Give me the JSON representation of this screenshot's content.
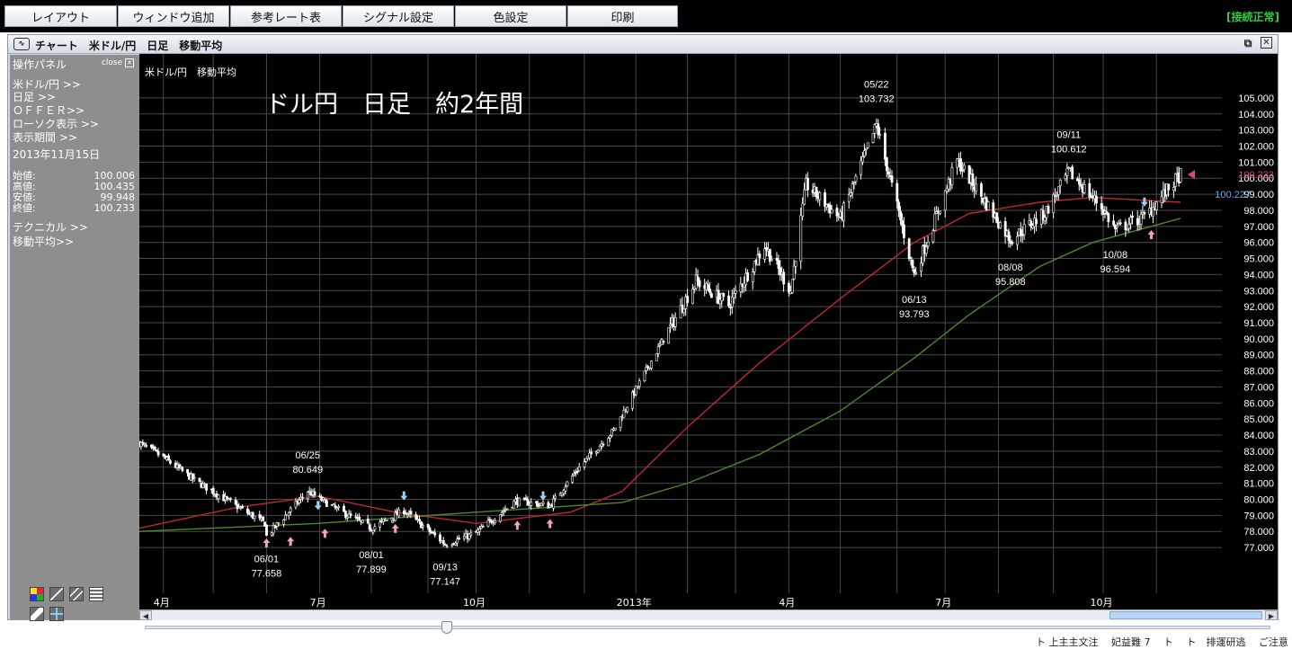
{
  "menu": {
    "items": [
      "レイアウト",
      "ウィンドウ追加",
      "参考レート表",
      "シグナル設定",
      "色設定",
      "印刷"
    ],
    "status": "[接続正常]"
  },
  "window": {
    "title": "チャート　米ドル/円　日足　移動平均",
    "icon": "chart-wave-icon",
    "controls": [
      "popout-icon",
      "close-icon"
    ]
  },
  "panel": {
    "title": "操作パネル",
    "close_label": "close",
    "links": [
      "米ドル/円 >>",
      "日足 >>",
      "ＯＦＦＥＲ>>",
      "ローソク表示 >>",
      "表示期間 >>"
    ],
    "date": "2013年11月15日",
    "ohlc": [
      {
        "label": "始値:",
        "value": "100.006"
      },
      {
        "label": "高値:",
        "value": "100.435"
      },
      {
        "label": "安値:",
        "value": "99.948"
      },
      {
        "label": "終値:",
        "value": "100.233"
      }
    ],
    "technical_link": "テクニカル >>",
    "ma_link": "移動平均>>",
    "tool_icons": [
      "color-palette-icon",
      "line-draw-icon",
      "parallel-lines-icon",
      "list-icon",
      "eraser-icon",
      "crosshair-icon"
    ]
  },
  "chart": {
    "subtitle": "米ドル/円　移動平均",
    "overlay_title": "ドル円　日足　約2年間",
    "colors": {
      "candle": "#ffffff",
      "ma_short": "#c0282d",
      "ma_long": "#4d8a2a",
      "grid": "#4a4a4a",
      "last_price": "#e0447a",
      "ma_value": "#6fa0e8",
      "buy_arrow": "#f2a6b8",
      "sell_arrow": "#9fd0f2"
    },
    "last_price": "100.233",
    "ma_value": "100.227",
    "annotations": [
      {
        "date": "06/01",
        "price": "77.658"
      },
      {
        "date": "06/25",
        "price": "80.649"
      },
      {
        "date": "08/01",
        "price": "77.899"
      },
      {
        "date": "09/13",
        "price": "77.147"
      },
      {
        "date": "05/22",
        "price": "103.732"
      },
      {
        "date": "06/13",
        "price": "93.793"
      },
      {
        "date": "08/08",
        "price": "95.808"
      },
      {
        "date": "09/11",
        "price": "100.612"
      },
      {
        "date": "10/08",
        "price": "96.594"
      }
    ]
  },
  "chart_data": {
    "type": "candlestick",
    "ylim": [
      76.5,
      105.5
    ],
    "y_ticks": [
      "77.000",
      "78.000",
      "79.000",
      "80.000",
      "81.000",
      "82.000",
      "83.000",
      "84.000",
      "85.000",
      "86.000",
      "87.000",
      "88.000",
      "89.000",
      "90.000",
      "91.000",
      "92.000",
      "93.000",
      "94.000",
      "95.000",
      "96.000",
      "97.000",
      "98.000",
      "99.000",
      "100.000",
      "101.000",
      "102.000",
      "103.000",
      "104.000",
      "105.000"
    ],
    "x_ticks": [
      "4月",
      "7月",
      "10月",
      "2013年",
      "4月",
      "7月",
      "10月"
    ],
    "close_path": [
      {
        "date": "2012-03-19",
        "close": 83.5
      },
      {
        "date": "2012-04-02",
        "close": 82.6
      },
      {
        "date": "2012-04-20",
        "close": 81.2
      },
      {
        "date": "2012-05-08",
        "close": 80.0
      },
      {
        "date": "2012-05-31",
        "close": 78.5
      },
      {
        "date": "2012-06-01",
        "close": 77.7
      },
      {
        "date": "2012-06-25",
        "close": 80.5
      },
      {
        "date": "2012-07-10",
        "close": 79.5
      },
      {
        "date": "2012-08-01",
        "close": 78.2
      },
      {
        "date": "2012-08-20",
        "close": 79.3
      },
      {
        "date": "2012-09-13",
        "close": 77.2
      },
      {
        "date": "2012-10-01",
        "close": 77.9
      },
      {
        "date": "2012-10-24",
        "close": 79.9
      },
      {
        "date": "2012-11-13",
        "close": 79.6
      },
      {
        "date": "2012-11-30",
        "close": 82.0
      },
      {
        "date": "2012-12-20",
        "close": 84.3
      },
      {
        "date": "2013-01-14",
        "close": 89.2
      },
      {
        "date": "2013-02-06",
        "close": 93.6
      },
      {
        "date": "2013-02-25",
        "close": 92.1
      },
      {
        "date": "2013-03-18",
        "close": 95.8
      },
      {
        "date": "2013-04-02",
        "close": 93.0
      },
      {
        "date": "2013-04-11",
        "close": 99.6
      },
      {
        "date": "2013-05-01",
        "close": 97.5
      },
      {
        "date": "2013-05-22",
        "close": 103.3
      },
      {
        "date": "2013-06-13",
        "close": 94.0
      },
      {
        "date": "2013-07-08",
        "close": 101.1
      },
      {
        "date": "2013-08-08",
        "close": 96.2
      },
      {
        "date": "2013-08-28",
        "close": 97.8
      },
      {
        "date": "2013-09-11",
        "close": 100.4
      },
      {
        "date": "2013-09-30",
        "close": 98.2
      },
      {
        "date": "2013-10-08",
        "close": 96.8
      },
      {
        "date": "2013-10-25",
        "close": 97.6
      },
      {
        "date": "2013-11-15",
        "close": 100.233
      }
    ],
    "series": [
      {
        "name": "",
        "color": "#c0282d",
        "values": [
          {
            "date": "2012-03-19",
            "value": 78.2
          },
          {
            "date": "2012-05-15",
            "value": 79.5
          },
          {
            "date": "2012-07-01",
            "value": 80.2
          },
          {
            "date": "2012-08-15",
            "value": 79.2
          },
          {
            "date": "2012-10-01",
            "value": 78.5
          },
          {
            "date": "2012-11-25",
            "value": 79.2
          },
          {
            "date": "2012-12-25",
            "value": 80.5
          },
          {
            "date": "2013-02-01",
            "value": 84.5
          },
          {
            "date": "2013-03-15",
            "value": 88.5
          },
          {
            "date": "2013-05-01",
            "value": 92.5
          },
          {
            "date": "2013-06-13",
            "value": 96.0
          },
          {
            "date": "2013-07-15",
            "value": 97.8
          },
          {
            "date": "2013-08-25",
            "value": 98.5
          },
          {
            "date": "2013-09-25",
            "value": 98.8
          },
          {
            "date": "2013-11-15",
            "value": 98.5
          }
        ]
      },
      {
        "name": "",
        "color": "#4d8a2a",
        "values": [
          {
            "date": "2012-03-19",
            "value": 78.0
          },
          {
            "date": "2012-07-01",
            "value": 78.5
          },
          {
            "date": "2012-10-01",
            "value": 79.2
          },
          {
            "date": "2012-12-25",
            "value": 79.8
          },
          {
            "date": "2013-02-01",
            "value": 81.0
          },
          {
            "date": "2013-03-15",
            "value": 82.8
          },
          {
            "date": "2013-05-01",
            "value": 85.5
          },
          {
            "date": "2013-06-13",
            "value": 88.8
          },
          {
            "date": "2013-07-15",
            "value": 91.5
          },
          {
            "date": "2013-08-25",
            "value": 94.5
          },
          {
            "date": "2013-09-25",
            "value": 96.0
          },
          {
            "date": "2013-11-15",
            "value": 97.5
          }
        ]
      }
    ],
    "signals": [
      {
        "type": "buy",
        "date": "2012-06-01",
        "price": 77.9
      },
      {
        "type": "buy",
        "date": "2012-06-15",
        "price": 78.0
      },
      {
        "type": "sell",
        "date": "2012-07-01",
        "price": 79.0
      },
      {
        "type": "buy",
        "date": "2012-07-05",
        "price": 78.5
      },
      {
        "type": "buy",
        "date": "2012-08-15",
        "price": 78.8
      },
      {
        "type": "sell",
        "date": "2012-08-20",
        "price": 79.6
      },
      {
        "type": "buy",
        "date": "2012-10-25",
        "price": 79.0
      },
      {
        "type": "buy",
        "date": "2012-11-13",
        "price": 79.1
      },
      {
        "type": "sell",
        "date": "2012-11-09",
        "price": 79.6
      },
      {
        "type": "sell",
        "date": "2013-10-25",
        "price": 97.9
      },
      {
        "type": "buy",
        "date": "2013-10-29",
        "price": 97.1
      }
    ]
  },
  "footer": {
    "text": "ト 上主主文注 　妃益難 7　 ト 　ト　排運研逃 　ご注意"
  }
}
